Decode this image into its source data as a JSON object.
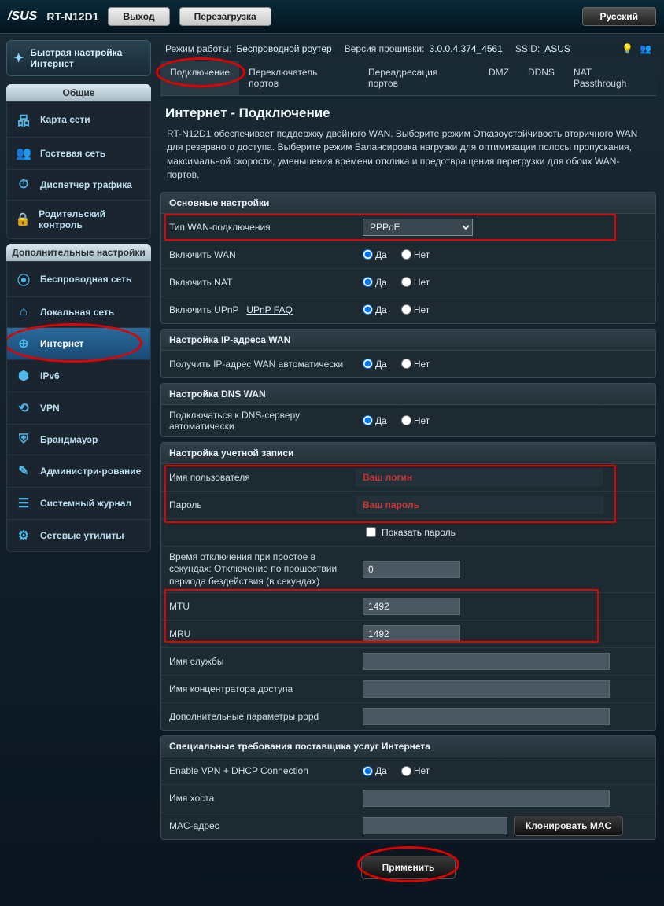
{
  "header": {
    "brand": "/SUS",
    "model": "RT-N12D1",
    "logout": "Выход",
    "reboot": "Перезагрузка",
    "language": "Русский"
  },
  "status": {
    "mode_label": "Режим работы:",
    "mode_value": "Беспроводной роутер",
    "fw_label": "Версия прошивки:",
    "fw_value": "3.0.0.4.374_4561",
    "ssid_label": "SSID:",
    "ssid_value": "ASUS"
  },
  "quick": "Быстрая настройка Интернет",
  "section_general": "Общие",
  "general_items": [
    {
      "label": "Карта сети"
    },
    {
      "label": "Гостевая сеть"
    },
    {
      "label": "Диспетчер трафика"
    },
    {
      "label": "Родительский контроль"
    }
  ],
  "section_adv": "Дополнительные настройки",
  "adv_items": [
    {
      "label": "Беспроводная сеть"
    },
    {
      "label": "Локальная сеть"
    },
    {
      "label": "Интернет"
    },
    {
      "label": "IPv6"
    },
    {
      "label": "VPN"
    },
    {
      "label": "Брандмауэр"
    },
    {
      "label": "Администри-рование"
    },
    {
      "label": "Системный журнал"
    },
    {
      "label": "Сетевые утилиты"
    }
  ],
  "tabs": [
    "Подключение",
    "Переключатель портов",
    "Переадресация портов",
    "DMZ",
    "DDNS",
    "NAT Passthrough"
  ],
  "page": {
    "title": "Интернет - Подключение",
    "desc": "RT-N12D1 обеспечивает поддержку двойного WAN. Выберите режим Отказоустойчивость вторичного WAN для резервного доступа. Выберите режим Балансировка нагрузки для оптимизации полосы пропускания, максимальной скорости, уменьшения времени отклика и предотвращения перегрузки для обоих WAN-портов."
  },
  "panels": {
    "basic": {
      "head": "Основные настройки",
      "wan_type_label": "Тип WAN-подключения",
      "wan_type_value": "PPPoE",
      "enable_wan": "Включить WAN",
      "enable_nat": "Включить NAT",
      "enable_upnp": "Включить UPnP",
      "upnp_faq": "UPnP  FAQ"
    },
    "wanip": {
      "head": "Настройка IP-адреса WAN",
      "auto_label": "Получить IP-адрес WAN автоматически"
    },
    "dns": {
      "head": "Настройка DNS WAN",
      "auto_label": "Подключаться к DNS-серверу автоматически"
    },
    "acct": {
      "head": "Настройка учетной записи",
      "user": "Имя пользователя",
      "pass": "Пароль",
      "user_hint": "Ваш логин",
      "pass_hint": "Ваш пароль",
      "showpass": "Показать пароль",
      "idle": "Время отключения при простое в секундах: Отключение по прошествии периода бездействия (в секундах)",
      "idle_val": "0",
      "mtu": "MTU",
      "mtu_val": "1492",
      "mru": "MRU",
      "mru_val": "1492",
      "service": "Имя службы",
      "ac": "Имя концентратора доступа",
      "pppd": "Дополнительные параметры pppd"
    },
    "isp": {
      "head": "Специальные требования поставщика услуг Интернета",
      "vpn": "Enable VPN + DHCP Connection",
      "host": "Имя хоста",
      "mac": "MAC-адрес",
      "clone": "Клонировать MAC"
    }
  },
  "yes": "Да",
  "no": "Нет",
  "apply": "Применить"
}
